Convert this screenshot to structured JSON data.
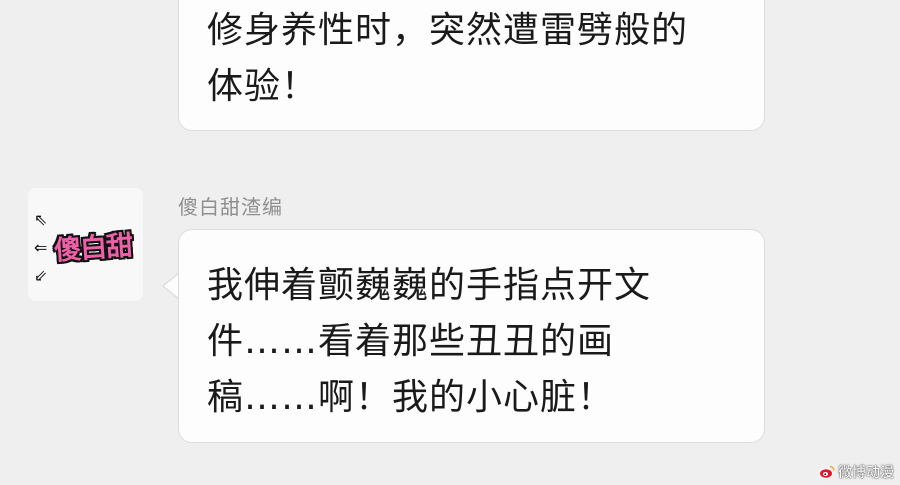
{
  "messages": [
    {
      "lines": [
        "修身养性时，突然遭雷劈般的",
        "体验！"
      ]
    },
    {
      "sender": "傻白甜渣编",
      "avatar_text": "傻白甜",
      "lines": [
        "我伸着颤巍巍的手指点开文",
        "件……看着那些丑丑的画",
        "稿……啊！我的小心脏！"
      ]
    }
  ],
  "watermark": {
    "text": "微博动漫",
    "icon": "weibo-icon"
  }
}
